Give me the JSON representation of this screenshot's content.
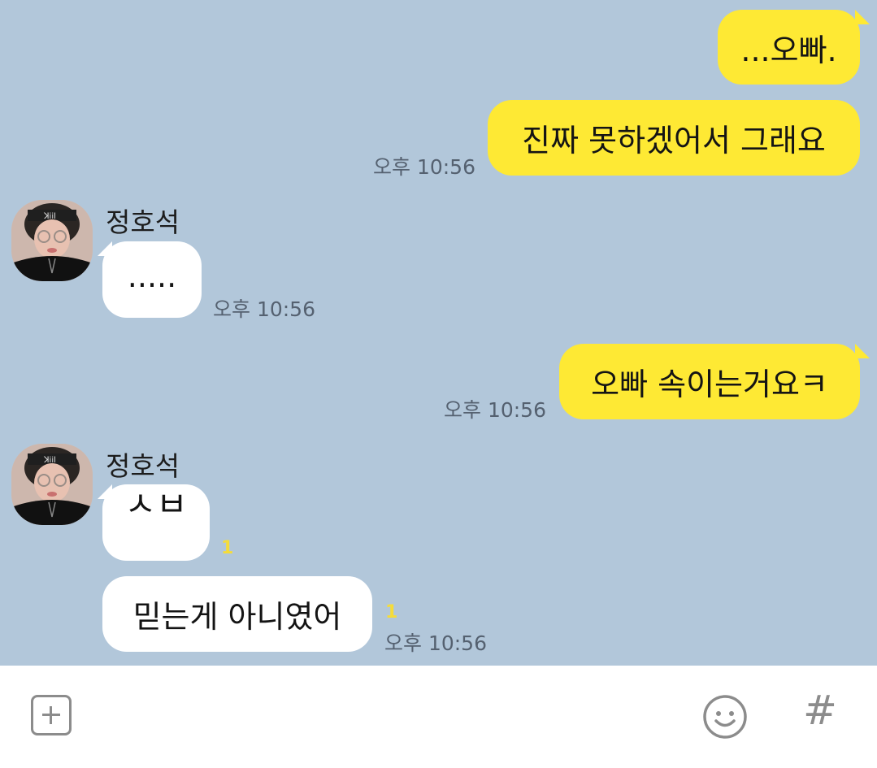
{
  "messages": [
    {
      "side": "me",
      "text": "...오빠."
    },
    {
      "side": "me",
      "text": "진짜 못하겠어서 그래요",
      "time": "오후 10:56"
    },
    {
      "side": "them",
      "sender": "정호석",
      "text": ".....",
      "time": "오후 10:56"
    },
    {
      "side": "me",
      "text": "오빠 속이는거요ㅋ",
      "time": "오후 10:56"
    },
    {
      "side": "them",
      "sender": "정호석",
      "text": "ㅅㅂ",
      "unread": "1"
    },
    {
      "side": "them",
      "text": "믿는게 아니였어",
      "unread": "1",
      "time": "오후 10:56"
    }
  ],
  "input_bar": {
    "plus_icon": "plus-square-icon",
    "emoji_icon": "smiley-face-icon",
    "hash_icon": "hash-icon",
    "hash_glyph": "#"
  },
  "colors": {
    "background": "#b2c7da",
    "my_bubble": "#fee934",
    "their_bubble": "#ffffff",
    "unread_count": "#f5dc3a"
  }
}
